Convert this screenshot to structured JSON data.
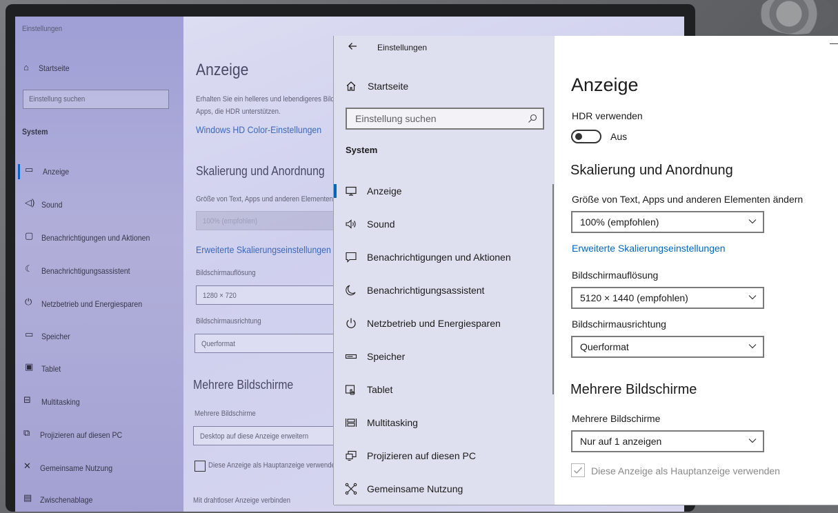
{
  "background_photo": {
    "window_title": "Einstellungen",
    "home": "Startseite",
    "search_placeholder": "Einstellung suchen",
    "section": "System",
    "nav": [
      "Anzeige",
      "Sound",
      "Benachrichtigungen und Aktionen",
      "Benachrichtigungsassistent",
      "Netzbetrieb und Energiesparen",
      "Speicher",
      "Tablet",
      "Multitasking",
      "Projizieren auf diesen PC",
      "Gemeinsame Nutzung",
      "Zwischenablage"
    ],
    "page_title": "Anzeige",
    "intro": [
      "Erhalten Sie ein helleres und lebendigeres Bild",
      "Apps, die HDR unterstützen."
    ],
    "hdr_link": "Windows HD Color-Einstellungen",
    "scaling_heading": "Skalierung und Anordnung",
    "scaling_label": "Größe von Text, Apps und anderen Elementen",
    "scaling_value": "100% (empfohlen)",
    "advanced_link": "Erweiterte Skalierungseinstellungen",
    "resolution_label": "Bildschirmauflösung",
    "resolution_value": "1280 × 720",
    "orientation_label": "Bildschirmausrichtung",
    "orientation_value": "Querformat",
    "multi_heading": "Mehrere Bildschirme",
    "multi_label": "Mehrere Bildschirme",
    "multi_value": "Desktop auf diese Anzeige erweitern",
    "primary_checkbox": "Diese Anzeige als Hauptanzeige verwende",
    "wireless_link": "Mit drahtloser Anzeige verbinden"
  },
  "window": {
    "title": "Einstellungen",
    "home": "Startseite",
    "search_placeholder": "Einstellung suchen",
    "section": "System",
    "nav": [
      {
        "label": "Anzeige",
        "icon": "monitor-icon",
        "selected": true
      },
      {
        "label": "Sound",
        "icon": "speaker-icon"
      },
      {
        "label": "Benachrichtigungen und Aktionen",
        "icon": "notification-icon"
      },
      {
        "label": "Benachrichtigungsassistent",
        "icon": "moon-icon"
      },
      {
        "label": "Netzbetrieb und Energiesparen",
        "icon": "power-icon"
      },
      {
        "label": "Speicher",
        "icon": "storage-icon"
      },
      {
        "label": "Tablet",
        "icon": "tablet-icon"
      },
      {
        "label": "Multitasking",
        "icon": "multitasking-icon"
      },
      {
        "label": "Projizieren auf diesen PC",
        "icon": "project-icon"
      },
      {
        "label": "Gemeinsame Nutzung",
        "icon": "shared-experiences-icon"
      }
    ]
  },
  "content": {
    "page_title": "Anzeige",
    "hdr_label": "HDR verwenden",
    "hdr_state": "Aus",
    "scaling_heading": "Skalierung und Anordnung",
    "scaling_label": "Größe von Text, Apps und anderen Elementen ändern",
    "scaling_value": "100% (empfohlen)",
    "advanced_link": "Erweiterte Skalierungseinstellungen",
    "resolution_label": "Bildschirmauflösung",
    "resolution_value": "5120 × 1440 (empfohlen)",
    "orientation_label": "Bildschirmausrichtung",
    "orientation_value": "Querformat",
    "multi_heading": "Mehrere Bildschirme",
    "multi_label": "Mehrere Bildschirme",
    "multi_value": "Nur auf 1 anzeigen",
    "primary_checkbox": "Diese Anzeige als Hauptanzeige verwenden",
    "primary_checked": true
  },
  "colors": {
    "accent": "#0067c0",
    "nav_background": "#dee0ef",
    "text": "#1b1b1b",
    "disabled_text": "#8a8a8a"
  }
}
